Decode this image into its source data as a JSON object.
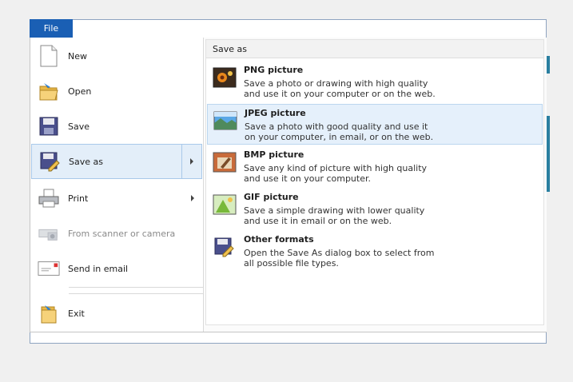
{
  "file_tab": {
    "label": "File"
  },
  "left_menu": {
    "items": [
      {
        "label": "New"
      },
      {
        "label": "Open"
      },
      {
        "label": "Save"
      },
      {
        "label": "Save as"
      },
      {
        "label": "Print"
      },
      {
        "label": "From scanner or camera"
      },
      {
        "label": "Send in email"
      },
      {
        "label": "Exit"
      }
    ]
  },
  "save_as_panel": {
    "title": "Save as",
    "options": [
      {
        "title": "PNG picture",
        "desc": "Save a photo or drawing with high quality\nand use it on your computer or on the web."
      },
      {
        "title": "JPEG picture",
        "desc": "Save a photo with good quality and use it\non your computer, in email, or on the web."
      },
      {
        "title": "BMP picture",
        "desc": "Save any kind of picture with high quality\nand use it on your computer."
      },
      {
        "title": "GIF picture",
        "desc": "Save a simple drawing with lower quality\nand use it in email or on the web."
      },
      {
        "title": "Other formats",
        "desc": "Open the Save As dialog box to select from\nall possible file types."
      }
    ]
  },
  "icons": {
    "new": "new-document-icon",
    "open": "open-folder-icon",
    "save": "floppy-disk-icon",
    "save_as": "save-as-icon",
    "print": "printer-icon",
    "scanner": "scanner-camera-icon",
    "email": "email-icon",
    "exit": "exit-icon"
  },
  "colors": {
    "file_tab": "#1a5fb4",
    "selection": "#e3eef9",
    "selection_border": "#a9c9ea"
  }
}
